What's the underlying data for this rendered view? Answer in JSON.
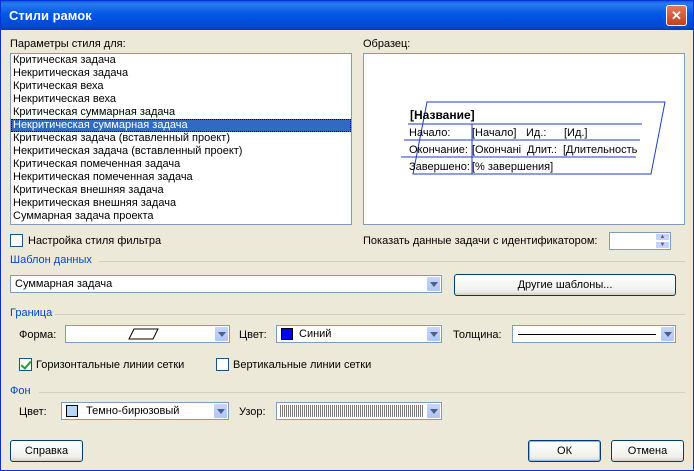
{
  "window": {
    "title": "Стили рамок",
    "close_label": "✕"
  },
  "style_params": {
    "label": "Параметры стиля для:",
    "items": [
      "Критическая задача",
      "Некритическая задача",
      "Критическая веха",
      "Некритическая веха",
      "Критическая суммарная задача",
      "Некритическая суммарная задача",
      "Критическая задача (вставленный проект)",
      "Некритическая задача (вставленный проект)",
      "Критическая помеченная задача",
      "Некритическая помеченная задача",
      "Критическая внешняя задача",
      "Некритическая внешняя задача",
      "Суммарная задача проекта"
    ],
    "selected_index": 5
  },
  "sample": {
    "label": "Образец:",
    "name": "[Название]",
    "start_label": "Начало:",
    "start_value": "[Начало]",
    "id_label": "Ид.:",
    "id_value": "[Ид.]",
    "finish_label": "Окончание:",
    "finish_value": "[Окончані",
    "duration_label": "Длит.:",
    "duration_value": "[Длительность",
    "complete_label": "Завершено:",
    "complete_value": "[% завершения]"
  },
  "filter_style": {
    "label": "Настройка стиля фильтра",
    "checked": false
  },
  "show_task_id": {
    "label": "Показать данные задачи с идентификатором:",
    "value": ""
  },
  "data_template": {
    "section": "Шаблон данных",
    "value": "Суммарная задача",
    "more_button": "Другие шаблоны..."
  },
  "border": {
    "section": "Граница",
    "shape_label": "Форма:",
    "color_label": "Цвет:",
    "color_value": "Синий",
    "color_hex": "#0000ff",
    "thickness_label": "Толщина:",
    "h_grid": {
      "label": "Горизонтальные линии сетки",
      "checked": true
    },
    "v_grid": {
      "label": "Вертикальные линии сетки",
      "checked": false
    }
  },
  "background": {
    "section": "Фон",
    "color_label": "Цвет:",
    "color_value": "Темно-бирюзовый",
    "color_hex": "#b3d7f5",
    "pattern_label": "Узор:"
  },
  "buttons": {
    "help": "Справка",
    "ok": "ОК",
    "cancel": "Отмена"
  }
}
